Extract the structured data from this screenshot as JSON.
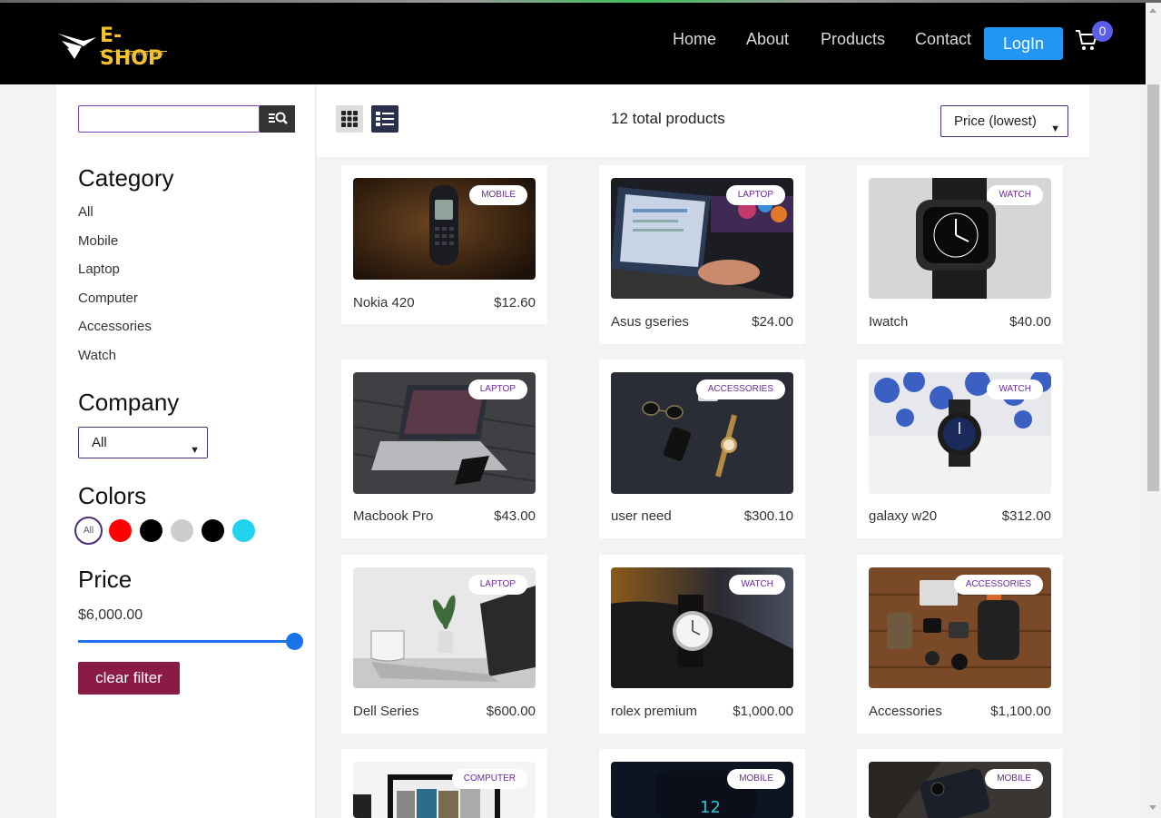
{
  "header": {
    "logo_title": "E-SHOP",
    "logo_tagline": "buy from home",
    "nav": [
      "Home",
      "About",
      "Products",
      "Contact"
    ],
    "login_label": "LogIn",
    "cart_count": "0"
  },
  "sidebar": {
    "search": {
      "value": "",
      "placeholder": ""
    },
    "category_heading": "Category",
    "categories": [
      "All",
      "Mobile",
      "Laptop",
      "Computer",
      "Accessories",
      "Watch"
    ],
    "company_heading": "Company",
    "company_selected": "All",
    "colors_heading": "Colors",
    "color_all_label": "All",
    "colors": [
      "#ff0000",
      "#000000",
      "#cccccc",
      "#000000",
      "#22d3ee"
    ],
    "price_heading": "Price",
    "price_value": "$6,000.00",
    "price_level": 1.0,
    "clear_label": "clear filter"
  },
  "toolbar": {
    "total": "12 total products",
    "sort_selected": "Price (lowest)"
  },
  "products": [
    {
      "name": "Nokia 420",
      "price": "$12.60",
      "category": "MOBILE"
    },
    {
      "name": "Asus gseries",
      "price": "$24.00",
      "category": "LAPTOP"
    },
    {
      "name": "Iwatch",
      "price": "$40.00",
      "category": "WATCH"
    },
    {
      "name": "Macbook Pro",
      "price": "$43.00",
      "category": "LAPTOP"
    },
    {
      "name": "user need",
      "price": "$300.10",
      "category": "ACCESSORIES"
    },
    {
      "name": "galaxy w20",
      "price": "$312.00",
      "category": "WATCH"
    },
    {
      "name": "Dell Series",
      "price": "$600.00",
      "category": "LAPTOP"
    },
    {
      "name": "rolex premium",
      "price": "$1,000.00",
      "category": "WATCH"
    },
    {
      "name": "Accessories",
      "price": "$1,100.00",
      "category": "ACCESSORIES"
    },
    {
      "name": "",
      "price": "",
      "category": "COMPUTER"
    },
    {
      "name": "",
      "price": "",
      "category": "MOBILE"
    },
    {
      "name": "",
      "price": "",
      "category": "MOBILE"
    }
  ],
  "colors": {
    "accent": "#2196f3",
    "clear_button": "#8a1b44",
    "badge_text": "#6b2a9a",
    "select_border": "#4b2d7a"
  }
}
